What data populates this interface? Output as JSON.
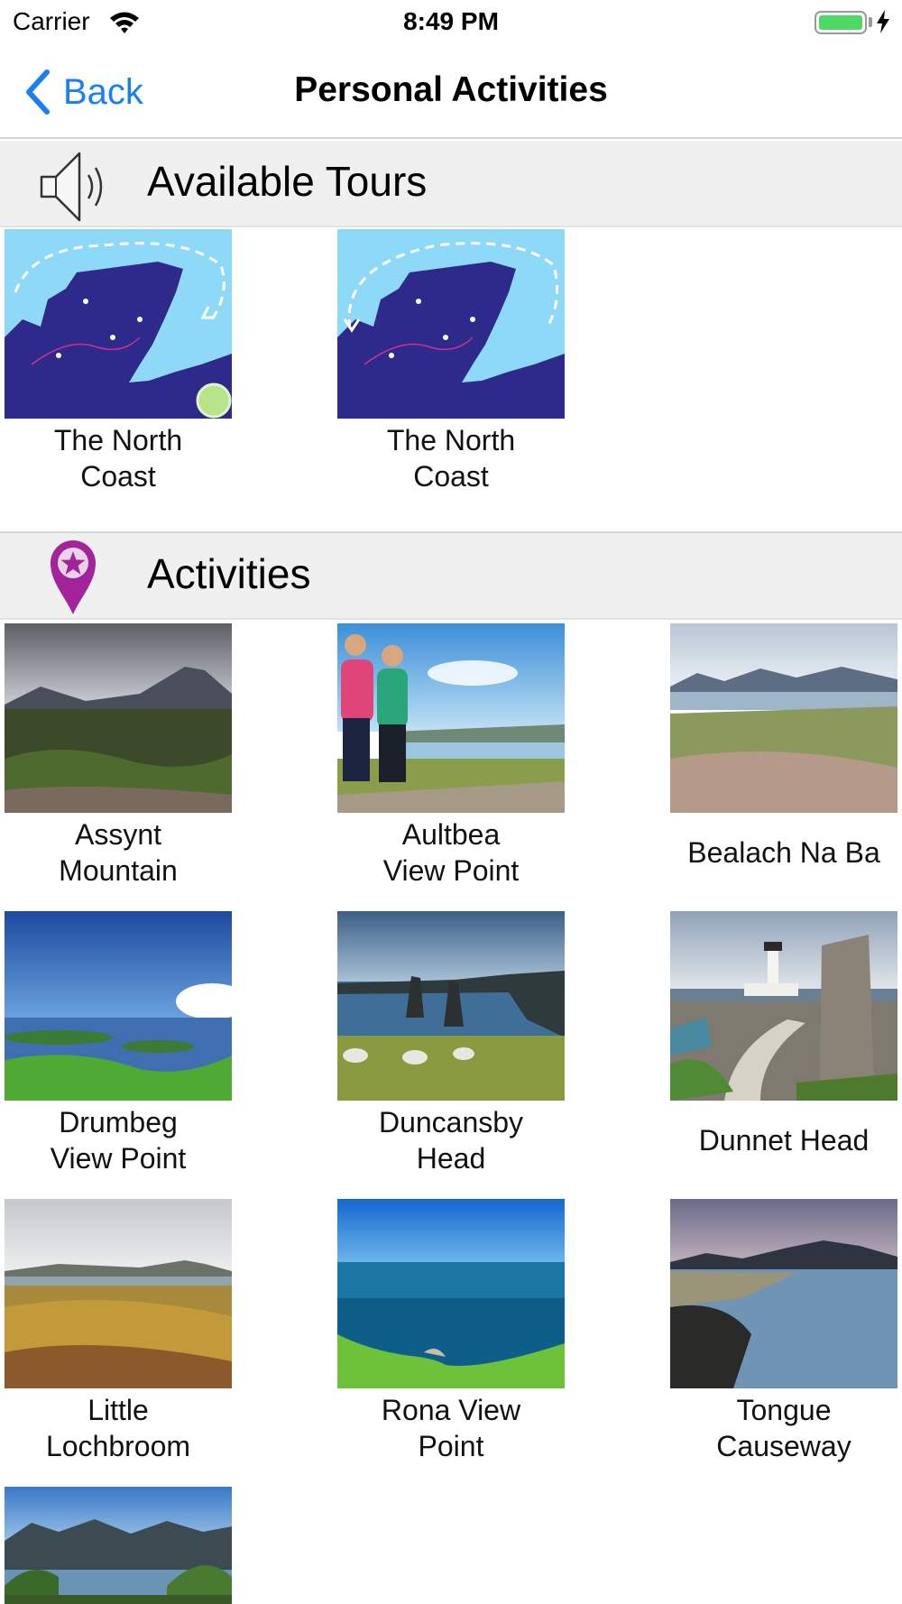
{
  "status_bar": {
    "carrier": "Carrier",
    "time": "8:49 PM",
    "battery_level": 1.0
  },
  "nav": {
    "back_label": "Back",
    "title": "Personal Activities"
  },
  "tours_section": {
    "title": "Available Tours",
    "items": [
      {
        "label_line1": "The North",
        "label_line2": "Coast",
        "image": "north-coast-map-clockwise"
      },
      {
        "label_line1": "The North",
        "label_line2": "Coast",
        "image": "north-coast-map-anticlockwise"
      }
    ]
  },
  "activities_section": {
    "title": "Activities",
    "items": [
      {
        "label_line1": "Assynt",
        "label_line2": "Mountain"
      },
      {
        "label_line1": "Aultbea",
        "label_line2": "View Point"
      },
      {
        "label_line1": "Bealach Na Ba",
        "label_line2": ""
      },
      {
        "label_line1": "Drumbeg",
        "label_line2": "View Point"
      },
      {
        "label_line1": "Duncansby",
        "label_line2": "Head"
      },
      {
        "label_line1": "Dunnet Head",
        "label_line2": ""
      },
      {
        "label_line1": "Little",
        "label_line2": "Lochbroom"
      },
      {
        "label_line1": "Rona View",
        "label_line2": "Point"
      },
      {
        "label_line1": "Tongue",
        "label_line2": "Causeway"
      },
      {
        "label_line1": "",
        "label_line2": ""
      }
    ]
  },
  "colors": {
    "accent": "#1a80f2",
    "pin": "#a3249a",
    "header_bg": "#f0f0f0",
    "map_sea": "#8ed8f8",
    "map_land": "#2e2a8c"
  }
}
